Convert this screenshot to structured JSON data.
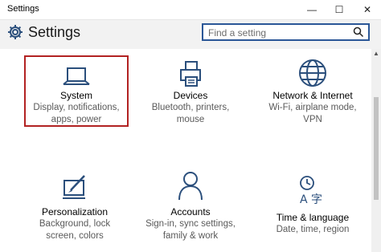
{
  "window": {
    "title": "Settings",
    "controls": {
      "minimize": "—",
      "maximize": "☐",
      "close": "✕"
    }
  },
  "header": {
    "title": "Settings",
    "search_placeholder": "Find a setting"
  },
  "categories": [
    {
      "title": "System",
      "desc_line1": "Display, notifications,",
      "desc_line2": "apps, power",
      "icon": "laptop-icon",
      "selected": true
    },
    {
      "title": "Devices",
      "desc_line1": "Bluetooth, printers,",
      "desc_line2": "mouse",
      "icon": "devices-icon"
    },
    {
      "title": "Network & Internet",
      "desc_line1": "Wi-Fi, airplane mode,",
      "desc_line2": "VPN",
      "icon": "globe-icon"
    },
    {
      "title": "Personalization",
      "desc_line1": "Background, lock",
      "desc_line2": "screen, colors",
      "icon": "personalization-icon"
    },
    {
      "title": "Accounts",
      "desc_line1": "Sign-in, sync settings,",
      "desc_line2": "family & work",
      "icon": "person-icon"
    },
    {
      "title": "Time & language",
      "desc_line1": "Date, time, region",
      "desc_line2": "",
      "icon": "time-language-icon"
    }
  ],
  "colors": {
    "accent": "#2b5797",
    "icon": "#2b4f7c",
    "selected_border": "#b22222"
  }
}
